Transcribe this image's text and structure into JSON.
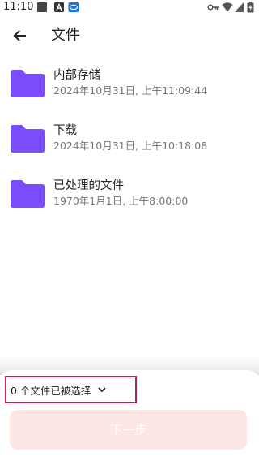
{
  "status_bar": {
    "time": "11:10",
    "icons": [
      "stop-square-icon",
      "app-a-icon",
      "app-360-icon",
      "key-icon",
      "wifi-icon",
      "signal-icon",
      "battery-icon"
    ]
  },
  "toolbar": {
    "back_icon": "arrow-left-icon",
    "title": "文件"
  },
  "folders": [
    {
      "name": "内部存储",
      "date": "2024年10月31日, 上午11:09:44",
      "icon": "folder-icon"
    },
    {
      "name": "下载",
      "date": "2024年10月31日, 上午10:18:08",
      "icon": "folder-icon"
    },
    {
      "name": "已处理的文件",
      "date": "1970年1月1日, 上午8:00:00",
      "icon": "folder-icon"
    }
  ],
  "bottom_sheet": {
    "selection_label": "0 个文件已被选择",
    "selection_icon": "chevron-down-icon",
    "next_label": "下一步"
  },
  "colors": {
    "folder": "#7b4dfa",
    "next_button_bg": "#fde6e4",
    "highlight_border": "#b0264f",
    "primary_text": "#222222",
    "secondary_text": "#777777"
  }
}
